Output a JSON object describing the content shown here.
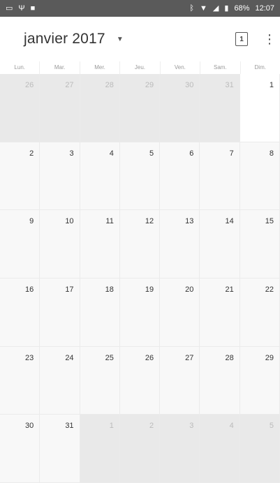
{
  "status_bar": {
    "battery": "68%",
    "time": "12:07"
  },
  "header": {
    "month_title": "janvier 2017",
    "today_label": "1"
  },
  "weekdays": [
    "Lun.",
    "Mar.",
    "Mer.",
    "Jeu.",
    "Ven.",
    "Sam.",
    "Dim."
  ],
  "weeks": [
    [
      {
        "day": "26",
        "current_month": false
      },
      {
        "day": "27",
        "current_month": false
      },
      {
        "day": "28",
        "current_month": false
      },
      {
        "day": "29",
        "current_month": false
      },
      {
        "day": "30",
        "current_month": false
      },
      {
        "day": "31",
        "current_month": false
      },
      {
        "day": "1",
        "current_month": true
      }
    ],
    [
      {
        "day": "2",
        "current_month": true
      },
      {
        "day": "3",
        "current_month": true
      },
      {
        "day": "4",
        "current_month": true
      },
      {
        "day": "5",
        "current_month": true
      },
      {
        "day": "6",
        "current_month": true
      },
      {
        "day": "7",
        "current_month": true
      },
      {
        "day": "8",
        "current_month": true
      }
    ],
    [
      {
        "day": "9",
        "current_month": true
      },
      {
        "day": "10",
        "current_month": true
      },
      {
        "day": "11",
        "current_month": true
      },
      {
        "day": "12",
        "current_month": true
      },
      {
        "day": "13",
        "current_month": true
      },
      {
        "day": "14",
        "current_month": true
      },
      {
        "day": "15",
        "current_month": true
      }
    ],
    [
      {
        "day": "16",
        "current_month": true
      },
      {
        "day": "17",
        "current_month": true
      },
      {
        "day": "18",
        "current_month": true
      },
      {
        "day": "19",
        "current_month": true
      },
      {
        "day": "20",
        "current_month": true
      },
      {
        "day": "21",
        "current_month": true
      },
      {
        "day": "22",
        "current_month": true
      }
    ],
    [
      {
        "day": "23",
        "current_month": true
      },
      {
        "day": "24",
        "current_month": true
      },
      {
        "day": "25",
        "current_month": true
      },
      {
        "day": "26",
        "current_month": true
      },
      {
        "day": "27",
        "current_month": true
      },
      {
        "day": "28",
        "current_month": true
      },
      {
        "day": "29",
        "current_month": true
      }
    ],
    [
      {
        "day": "30",
        "current_month": true
      },
      {
        "day": "31",
        "current_month": true
      },
      {
        "day": "1",
        "current_month": false
      },
      {
        "day": "2",
        "current_month": false
      },
      {
        "day": "3",
        "current_month": false
      },
      {
        "day": "4",
        "current_month": false
      },
      {
        "day": "5",
        "current_month": false
      }
    ]
  ],
  "colors": {
    "status_bar_bg": "#5a5a5a",
    "other_month_bg": "#e9e9e9",
    "current_month_bg": "#f8f8f8",
    "today_bg": "#ffffff"
  },
  "icons": {
    "status_left": [
      "notification-icon",
      "usb-icon",
      "lock-icon"
    ],
    "status_right": [
      "bluetooth-icon",
      "wifi-icon",
      "signal-icon",
      "battery-icon"
    ],
    "dropdown": "arrow-drop-down-icon",
    "today": "calendar-today-icon",
    "more": "more-vert-icon"
  }
}
